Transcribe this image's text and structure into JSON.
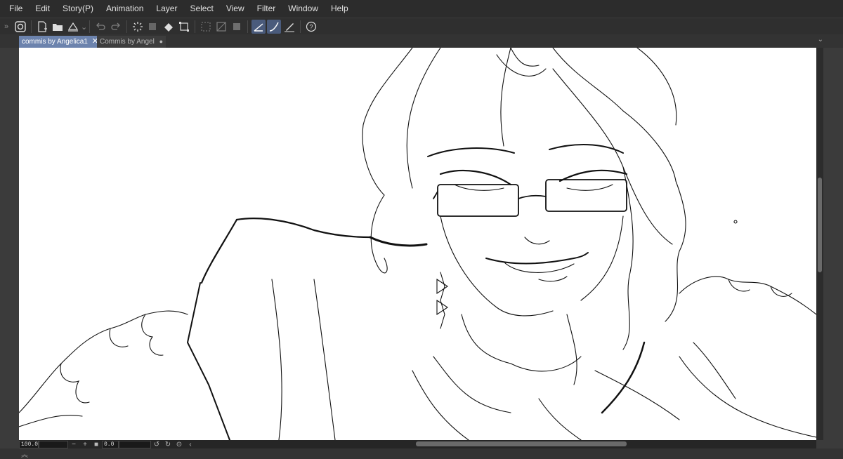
{
  "menu": [
    "File",
    "Edit",
    "Story(P)",
    "Animation",
    "Layer",
    "Select",
    "View",
    "Filter",
    "Window",
    "Help"
  ],
  "toolbar": {
    "icons": [
      "clip-studio-icon",
      "new-canvas-icon",
      "open-folder-icon",
      "save-icon",
      "undo-icon",
      "redo-icon",
      "loading-spinner-icon",
      "clear-icon",
      "fill-icon",
      "transform-icon",
      "hide-selection-icon",
      "snap-icon",
      "ruler-snap-icon",
      "pen-stroke-icon",
      "pen-curve-icon",
      "pen-edit-icon",
      "help-icon"
    ]
  },
  "tabs": [
    {
      "label": "commis by Angelica1",
      "active": true
    },
    {
      "label": "Commis by Angel",
      "active": false
    }
  ],
  "status": {
    "zoom": "100.0",
    "rotation": "0.0"
  },
  "colors": {
    "menubar": "#2c2c2c",
    "toolbar": "#2f2f2f",
    "active_tab": "#6c83ad",
    "canvas": "#ffffff",
    "active_tool": "#4a5b7c"
  }
}
